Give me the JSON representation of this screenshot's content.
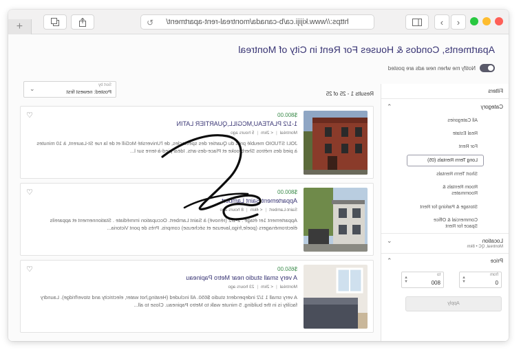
{
  "browser": {
    "url": "https://www.kijiji.ca/b-canada/montreal-rent-apartment/",
    "colors": {
      "close": "#fe5f57",
      "minimize": "#febc2e",
      "zoom": "#28c840"
    }
  },
  "page": {
    "title": "Apartments, Condos & Houses For Rent in City of Montreal",
    "notify_label": "Notify me when new ads are posted"
  },
  "filters": {
    "header": "Filters",
    "category_title": "Category",
    "categories": [
      "All Categories",
      "Real Estate",
      "For Rent",
      "Long Term Rentals (05)",
      "Short Term Rentals",
      "Room Rentals & Roommates",
      "Storage & Parking for Rent",
      "Commercial & Office Space for Rent"
    ],
    "location_title": "Location",
    "location_value": "Montreal, QC • 8km",
    "price_title": "Price",
    "price_from_caption": "from",
    "price_from_value": "0",
    "price_to_caption": "to",
    "price_to_value": "800",
    "apply_label": "Apply"
  },
  "results": {
    "count_label": "Results 1 - 25 of 25",
    "sort_caption": "Sort by",
    "sort_value": "Posted: newest first"
  },
  "listings": [
    {
      "price": "$800.00",
      "title": "1-1/2 PLATEAU,MCGILL,QUARTIER LATIN",
      "location": "Montréal",
      "distance": "< 2km",
      "posted": "5 hours ago",
      "description": "JOLI STUDIO meublé près du Quartier des spectacles, de l'Université McGill et de la rue St-Laurent, à 10 minutes à pied des métros Sherbrooke et Place-des-arts. Idéal pied-à-terre sur l..."
    },
    {
      "price": "$800.00",
      "title": "Appartement Saint Lambert",
      "location": "Saint-Lambert",
      "distance": "< 4km",
      "posted": "8 hours ago",
      "description": "Appartement 1er étage : 2-1/2 (rénové) à Saint Lambert. Occupation immédiate . Stationnement et appareils électroménagers (poele,frigo,laveuse et sécheuse) compris. Près de pont Victoria..."
    },
    {
      "price": "$650.00",
      "title": "A very small studio near Metro Papineau",
      "location": "Montréal",
      "distance": "< 2km",
      "posted": "23 hours ago",
      "description": "A very small 1 1/2 independent studio $650. All included (Heating,hot water, electricity and stove/fridge). Laundry facility is in the building. 5 minute walk to Metro Papineau. Close to all..."
    }
  ]
}
